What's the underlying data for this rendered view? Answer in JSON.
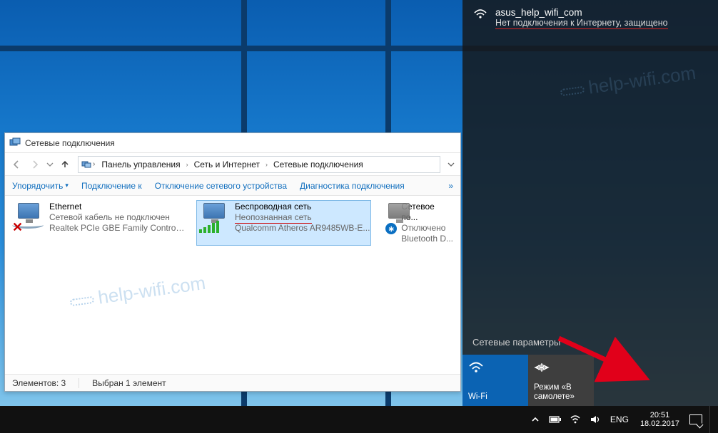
{
  "flyout": {
    "ssid": "asus_help_wifi_com",
    "status": "Нет подключения к Интернету, защищено",
    "section_label": "Сетевые параметры",
    "tiles": {
      "wifi_label": "Wi-Fi",
      "airplane_label": "Режим «В самолете»"
    }
  },
  "explorer": {
    "title": "Сетевые подключения",
    "breadcrumb": {
      "a": "Панель управления",
      "b": "Сеть и Интернет",
      "c": "Сетевые подключения"
    },
    "toolbar": {
      "organize": "Упорядочить",
      "connect": "Подключение к",
      "disable": "Отключение сетевого устройства",
      "diagnose": "Диагностика подключения"
    },
    "connections": {
      "ethernet": {
        "name": "Ethernet",
        "status": "Сетевой кабель не подключен",
        "device": "Realtek PCIe GBE Family Controller"
      },
      "wifi": {
        "name": "Беспроводная сеть",
        "status": "Неопознанная сеть",
        "device": "Qualcomm Atheros AR9485WB-E..."
      },
      "bt": {
        "name": "Сетевое по...",
        "status": "Отключено",
        "device": "Bluetooth D..."
      }
    },
    "statusbar": {
      "count": "Элементов: 3",
      "selected": "Выбран 1 элемент"
    }
  },
  "taskbar": {
    "lang": "ENG",
    "time": "20:51",
    "date": "18.02.2017"
  },
  "watermark": "help-wifi.com"
}
